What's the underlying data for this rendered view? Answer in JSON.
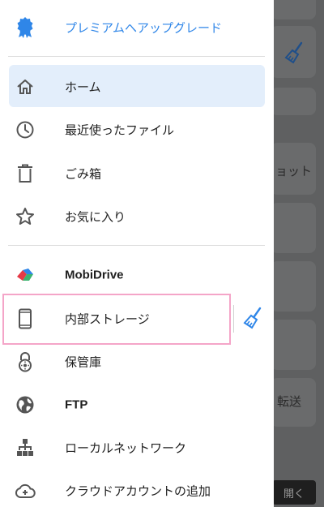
{
  "menu": {
    "premium": {
      "label": "プレミアムへアップグレード",
      "icon": "premium-badge-icon"
    },
    "home": {
      "label": "ホーム",
      "icon": "home-icon"
    },
    "recent": {
      "label": "最近使ったファイル",
      "icon": "clock-icon"
    },
    "trash": {
      "label": "ごみ箱",
      "icon": "trash-icon"
    },
    "favorites": {
      "label": "お気に入り",
      "icon": "star-icon"
    },
    "mobidrive": {
      "label": "MobiDrive",
      "icon": "mobidrive-logo-icon"
    },
    "internal_storage": {
      "label": "内部ストレージ",
      "icon": "phone-icon"
    },
    "vault": {
      "label": "保管庫",
      "icon": "vault-lock-icon"
    },
    "ftp": {
      "label": "FTP",
      "icon": "globe-icon"
    },
    "local_network": {
      "label": "ローカルネットワーク",
      "icon": "network-icon"
    },
    "add_cloud": {
      "label": "クラウドアカウントの追加",
      "icon": "cloud-add-icon"
    }
  },
  "background": {
    "text_screenshot": "ョット",
    "text_transfer": "転送",
    "open_button": "開く"
  },
  "colors": {
    "accent": "#2f86e8",
    "selected_bg": "#e3eefb",
    "highlight_border": "#f4a5c8"
  }
}
